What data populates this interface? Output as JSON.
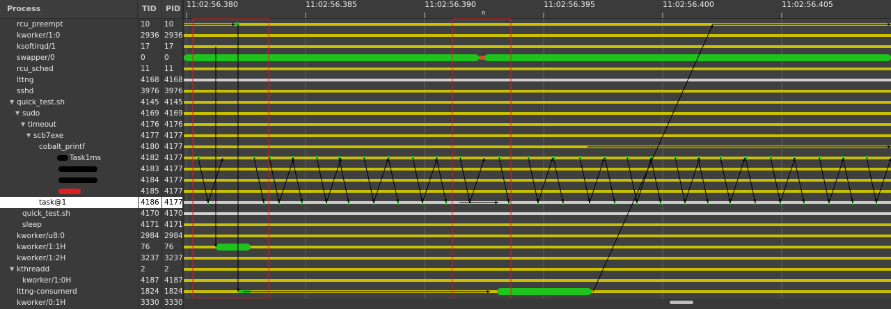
{
  "tree": {
    "headers": {
      "process": "Process",
      "tid": "TID",
      "pid": "PID"
    },
    "rows": [
      {
        "name": "rcu_preempt",
        "tid": "10",
        "pid": "10",
        "indent": 0,
        "expander": false
      },
      {
        "name": "kworker/1:0",
        "tid": "2936",
        "pid": "2936",
        "indent": 0,
        "expander": false
      },
      {
        "name": "ksoftirqd/1",
        "tid": "17",
        "pid": "17",
        "indent": 0,
        "expander": false
      },
      {
        "name": "swapper/0",
        "tid": "0",
        "pid": "0",
        "indent": 0,
        "expander": false
      },
      {
        "name": "rcu_sched",
        "tid": "11",
        "pid": "11",
        "indent": 0,
        "expander": false
      },
      {
        "name": "lttng",
        "tid": "4168",
        "pid": "4168",
        "indent": 0,
        "expander": false
      },
      {
        "name": "sshd",
        "tid": "3976",
        "pid": "3976",
        "indent": 0,
        "expander": false
      },
      {
        "name": "quick_test.sh",
        "tid": "4145",
        "pid": "4145",
        "indent": 0,
        "expander": true
      },
      {
        "name": "sudo",
        "tid": "4169",
        "pid": "4169",
        "indent": 1,
        "expander": true
      },
      {
        "name": "timeout",
        "tid": "4176",
        "pid": "4176",
        "indent": 2,
        "expander": true
      },
      {
        "name": "scb7exe",
        "tid": "4177",
        "pid": "4177",
        "indent": 3,
        "expander": true
      },
      {
        "name": "cobalt_printf",
        "tid": "4180",
        "pid": "4177",
        "indent": 4,
        "expander": false
      },
      {
        "name": "Task1ms",
        "tid": "4182",
        "pid": "4177",
        "indent": 4,
        "expander": false,
        "redact": "black-prefix"
      },
      {
        "name": "",
        "tid": "4183",
        "pid": "4177",
        "indent": 4,
        "expander": false,
        "redact": "black"
      },
      {
        "name": "",
        "tid": "4184",
        "pid": "4177",
        "indent": 4,
        "expander": false,
        "redact": "black"
      },
      {
        "name": "",
        "tid": "4185",
        "pid": "4177",
        "indent": 4,
        "expander": false,
        "redact": "red"
      },
      {
        "name": "task@1",
        "tid": "4186",
        "pid": "4177",
        "indent": 4,
        "expander": false,
        "selected": true
      },
      {
        "name": "quick_test.sh",
        "tid": "4170",
        "pid": "4170",
        "indent": 1,
        "expander": false
      },
      {
        "name": "sleep",
        "tid": "4171",
        "pid": "4171",
        "indent": 1,
        "expander": false
      },
      {
        "name": "kworker/u8:0",
        "tid": "2984",
        "pid": "2984",
        "indent": 0,
        "expander": false
      },
      {
        "name": "kworker/1:1H",
        "tid": "76",
        "pid": "76",
        "indent": 0,
        "expander": false
      },
      {
        "name": "kworker/1:2H",
        "tid": "3237",
        "pid": "3237",
        "indent": 0,
        "expander": false
      },
      {
        "name": "kthreadd",
        "tid": "2",
        "pid": "2",
        "indent": 0,
        "expander": true
      },
      {
        "name": "kworker/1:0H",
        "tid": "4187",
        "pid": "4187",
        "indent": 1,
        "expander": false
      },
      {
        "name": "lttng-consumerd",
        "tid": "1824",
        "pid": "1824",
        "indent": 0,
        "expander": false
      },
      {
        "name": "kworker/0:1H",
        "tid": "3330",
        "pid": "3330",
        "indent": 0,
        "expander": false
      }
    ]
  },
  "ruler": {
    "labels": [
      "11:02:56.380",
      "11:02:56.385",
      "11:02:56.390",
      "11:02:56.395",
      "11:02:56.400",
      "11:02:56.405"
    ],
    "marker": "π"
  },
  "colors": {
    "track_normal": "#c8c000",
    "track_selected": "#c8c8c8",
    "running": "#1cc41c",
    "arrow": "#000000",
    "highlight_box": "#cc2222",
    "redact_red": "#e02020",
    "redact_black": "#000000"
  }
}
